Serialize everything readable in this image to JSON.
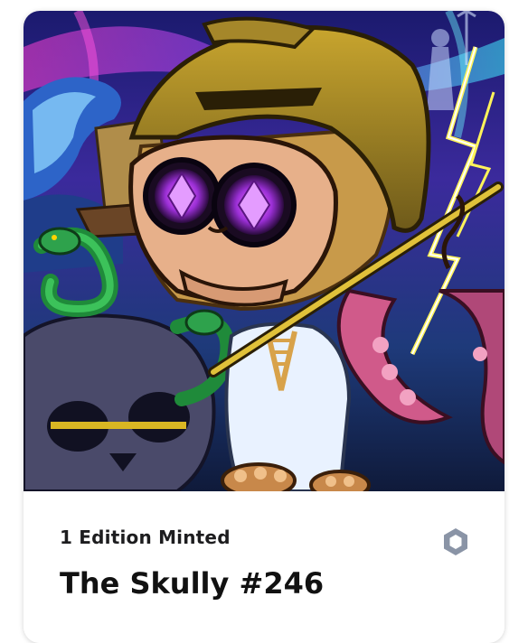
{
  "nft": {
    "edition_text": "1 Edition Minted",
    "title": "The Skully #246",
    "image_icon": "skull-warrior-artwork",
    "chain_icon": "hexagon-chain-icon"
  },
  "colors": {
    "background": "#ffffff",
    "title": "#111111",
    "chain_icon": "#8a94a6"
  }
}
